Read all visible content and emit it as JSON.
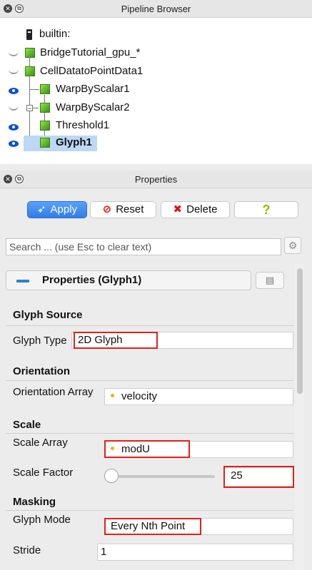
{
  "pipeline": {
    "title": "Pipeline Browser",
    "items": [
      {
        "label": "builtin:"
      },
      {
        "label": "BridgeTutorial_gpu_*"
      },
      {
        "label": "CellDatatoPointData1"
      },
      {
        "label": "WarpByScalar1"
      },
      {
        "label": "WarpByScalar2"
      },
      {
        "label": "Threshold1"
      },
      {
        "label": "Glyph1"
      }
    ]
  },
  "properties_panel": {
    "title": "Properties",
    "buttons": {
      "apply": "Apply",
      "reset": "Reset",
      "delete": "Delete",
      "help": "?"
    },
    "search_placeholder": "Search ... (use Esc to clear text)",
    "group_title": "Properties (Glyph1)",
    "sections": {
      "glyph_source": "Glyph Source",
      "orientation": "Orientation",
      "scale": "Scale",
      "masking": "Masking"
    },
    "fields": {
      "glyph_type_label": "Glyph Type",
      "glyph_type_value": "2D Glyph",
      "orientation_array_label": "Orientation Array",
      "orientation_array_value": "velocity",
      "scale_array_label": "Scale Array",
      "scale_array_value": "modU",
      "scale_factor_label": "Scale Factor",
      "scale_factor_value": "25",
      "glyph_mode_label": "Glyph Mode",
      "glyph_mode_value": "Every Nth Point",
      "stride_label": "Stride",
      "stride_value": "1"
    }
  },
  "colors": {
    "selection": "#bcd8f5",
    "apply_button": "#2f7de8",
    "highlight_box": "#e02020",
    "array_dot": "#e8b500"
  },
  "icons": [
    "close-icon",
    "float-icon",
    "eye-icon",
    "eye-hidden-icon",
    "server-icon",
    "cube-icon",
    "apply-icon",
    "reset-icon",
    "delete-icon",
    "help-icon",
    "gear-icon",
    "copy-icon",
    "minus-icon"
  ]
}
